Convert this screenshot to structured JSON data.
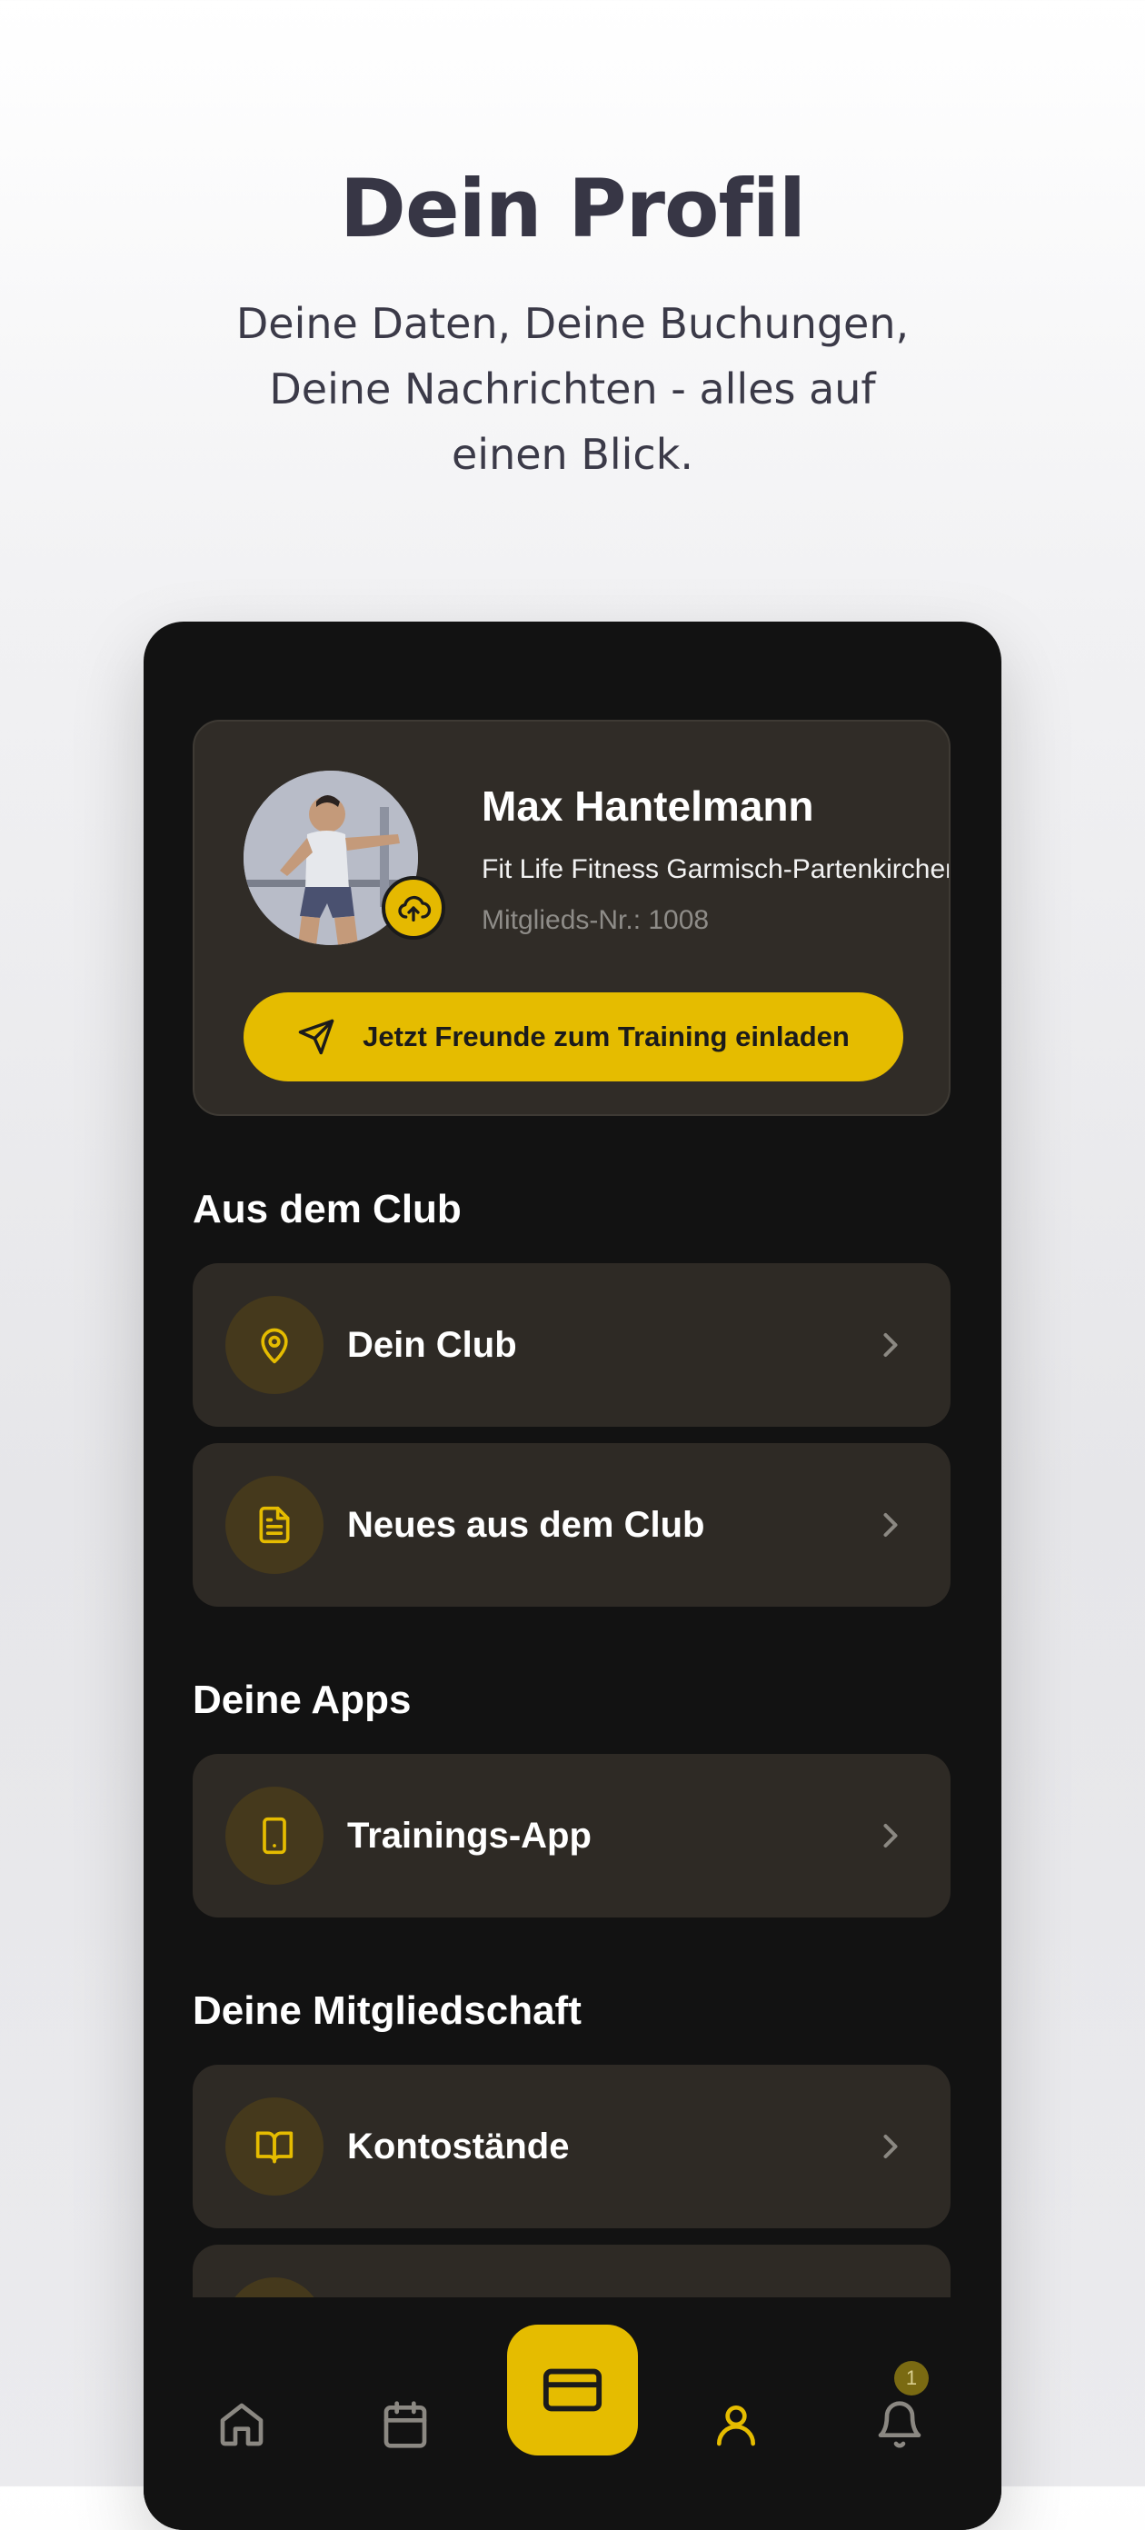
{
  "hero": {
    "title": "Dein Profil",
    "subtitle": "Deine Daten, Deine Buchungen, Deine Nachrichten - alles auf einen Blick."
  },
  "profile": {
    "name": "Max Hantelmann",
    "club": "Fit Life Fitness Garmisch-Partenkirchen",
    "member_no": "Mitglieds-Nr.: 1008",
    "invite_label": "Jetzt Freunde zum Training einladen"
  },
  "sections": {
    "club_title": "Aus dem Club",
    "apps_title": "Deine Apps",
    "membership_title": "Deine Mitgliedschaft"
  },
  "items": {
    "dein_club": {
      "label": "Dein Club",
      "icon": "map-pin-icon"
    },
    "news": {
      "label": "Neues aus dem Club",
      "icon": "document-icon"
    },
    "trainings_app": {
      "label": "Trainings-App",
      "icon": "smartphone-icon"
    },
    "kontostaende": {
      "label": "Kontostände",
      "icon": "book-icon"
    }
  },
  "tabbar": {
    "items": [
      "home-icon",
      "calendar-icon",
      "card-icon",
      "user-icon",
      "bell-icon"
    ],
    "notification_count": "1"
  },
  "colors": {
    "accent": "#e5bc00",
    "phone_bg": "#121212",
    "card_bg": "#2e2a25",
    "hero_text": "#373645"
  }
}
